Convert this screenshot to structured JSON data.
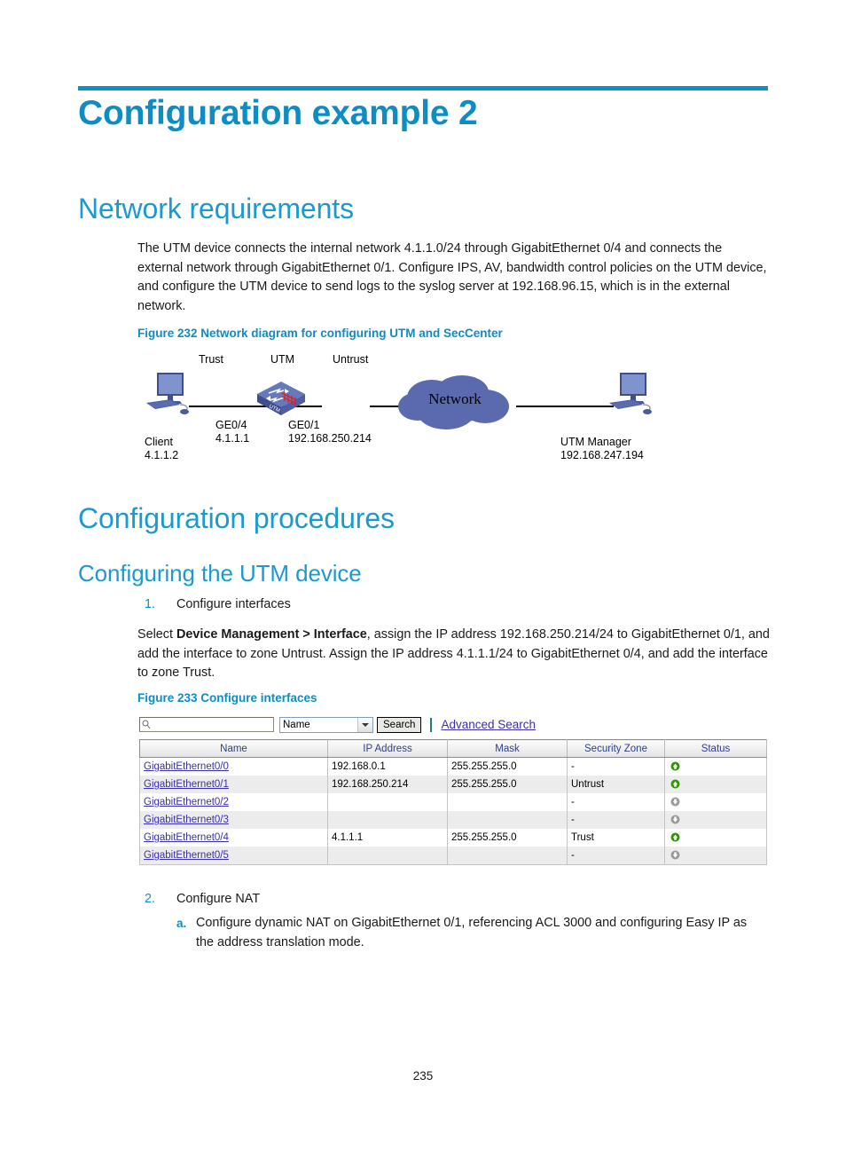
{
  "document": {
    "page_number": "235"
  },
  "headings": {
    "h1": "Configuration example 2",
    "network_requirements": "Network requirements",
    "configuration_procedures": "Configuration procedures",
    "configuring_utm_device": "Configuring the UTM device"
  },
  "paragraphs": {
    "intro": "The UTM device connects the internal network 4.1.1.0/24 through GigabitEthernet 0/4 and connects the external network through GigabitEthernet 0/1. Configure IPS, AV, bandwidth control policies on the UTM device, and configure the UTM device to send logs to the syslog server at 192.168.96.15, which is in the external network.",
    "select_prefix": "Select ",
    "select_bold": "Device Management > Interface",
    "select_suffix": ", assign the IP address 192.168.250.214/24 to GigabitEthernet 0/1, and add the interface to zone Untrust. Assign the IP address 4.1.1.1/24 to GigabitEthernet 0/4, and add the interface to zone Trust."
  },
  "figures": {
    "fig232_caption": "Figure 232 Network diagram for configuring UTM and SecCenter",
    "fig233_caption": "Figure 233 Configure interfaces"
  },
  "diagram": {
    "zone_trust": "Trust",
    "device_utm": "UTM",
    "zone_untrust": "Untrust",
    "cloud_label": "Network",
    "client_label": "Client\n4.1.1.2",
    "ge04_label": "GE0/4\n4.1.1.1",
    "ge01_label": "GE0/1\n192.168.250.214",
    "manager_label": "UTM Manager\n192.168.247.194",
    "device_badge": "UTM"
  },
  "steps": {
    "step1_marker": "1.",
    "step1_text": "Configure interfaces",
    "step2_marker": "2.",
    "step2_text": "Configure NAT",
    "step2a_marker": "a.",
    "step2a_text": "Configure dynamic NAT on GigabitEthernet 0/1, referencing ACL 3000 and configuring Easy IP as the address translation mode."
  },
  "ui": {
    "search": {
      "input_value": "",
      "input_placeholder": "",
      "filter_selected": "Name",
      "search_button": "Search",
      "advanced_search_link": "Advanced Search"
    },
    "table": {
      "columns": [
        "Name",
        "IP Address",
        "Mask",
        "Security Zone",
        "Status"
      ],
      "rows": [
        {
          "name": "GigabitEthernet0/0",
          "ip": "192.168.0.1",
          "mask": "255.255.255.0",
          "zone": "-",
          "status": "up"
        },
        {
          "name": "GigabitEthernet0/1",
          "ip": "192.168.250.214",
          "mask": "255.255.255.0",
          "zone": "Untrust",
          "status": "up"
        },
        {
          "name": "GigabitEthernet0/2",
          "ip": "",
          "mask": "",
          "zone": "-",
          "status": "down"
        },
        {
          "name": "GigabitEthernet0/3",
          "ip": "",
          "mask": "",
          "zone": "-",
          "status": "down"
        },
        {
          "name": "GigabitEthernet0/4",
          "ip": "4.1.1.1",
          "mask": "255.255.255.0",
          "zone": "Trust",
          "status": "up"
        },
        {
          "name": "GigabitEthernet0/5",
          "ip": "",
          "mask": "",
          "zone": "-",
          "status": "down"
        }
      ]
    }
  },
  "colors": {
    "heading_blue": "#0E8CC4",
    "subheading_blue": "#1C9AD0",
    "link_purple": "#3a2fb0",
    "table_header_text": "#2b3f8f",
    "status_up_green": "#2E9900",
    "status_down_gray": "#9a9a9a",
    "diagram_blue": "#5B6AAE"
  }
}
